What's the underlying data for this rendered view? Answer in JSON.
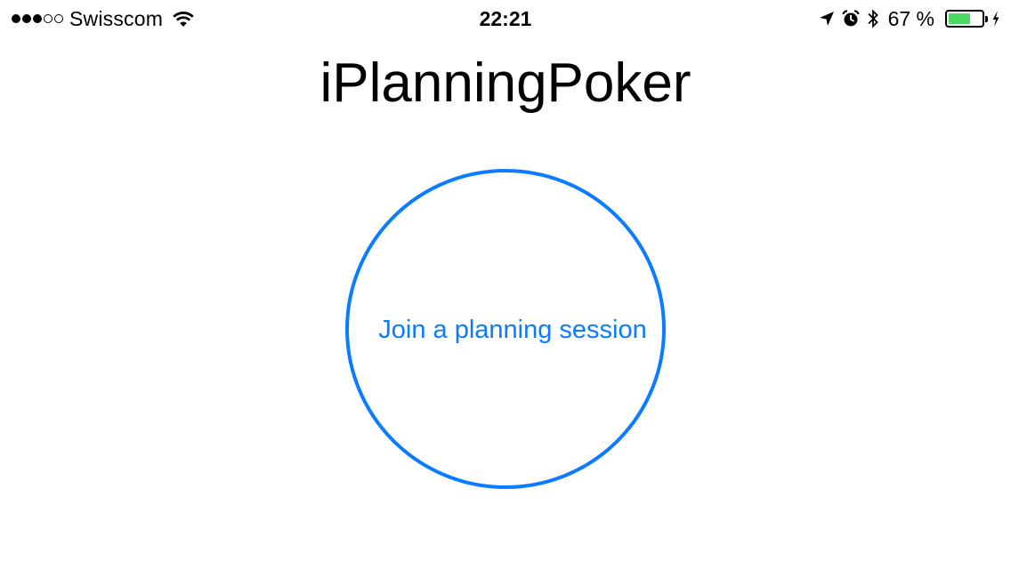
{
  "theme": {
    "accent": "#0a7cff",
    "battery_fill": "#4cd964"
  },
  "status_bar": {
    "signal_strength": 3,
    "signal_total": 5,
    "carrier": "Swisscom",
    "time": "22:21",
    "icons": [
      "wifi-icon",
      "location-arrow-icon",
      "alarm-icon",
      "bluetooth-icon",
      "charging-bolt-icon"
    ],
    "battery_percent": 67,
    "battery_label": "67 %"
  },
  "app": {
    "title": "iPlanningPoker"
  },
  "main": {
    "join_button_label": "Join a planning session"
  }
}
